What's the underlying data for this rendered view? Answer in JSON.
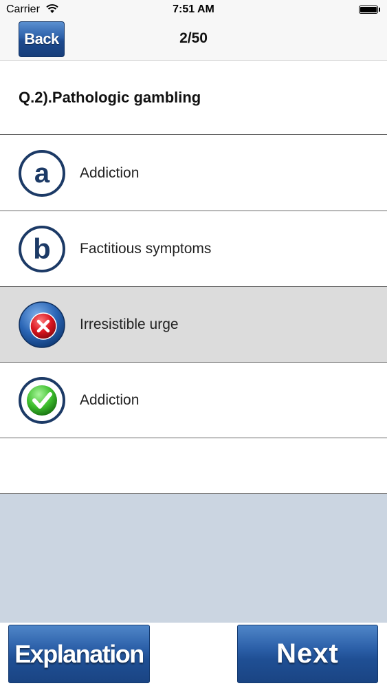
{
  "status_bar": {
    "carrier": "Carrier",
    "time": "7:51 AM"
  },
  "nav": {
    "back_label": "Back",
    "progress": "2/50"
  },
  "question": {
    "text": "Q.2).Pathologic gambling"
  },
  "options": [
    {
      "marker": "a",
      "icon": "letter-a-circle-icon",
      "label": "Addiction",
      "state": "normal"
    },
    {
      "marker": "b",
      "icon": "letter-b-circle-icon",
      "label": "Factitious symptoms",
      "state": "normal"
    },
    {
      "marker": "x",
      "icon": "wrong-answer-icon",
      "label": "Irresistible urge",
      "state": "selected-wrong"
    },
    {
      "marker": "check",
      "icon": "correct-answer-icon",
      "label": "Addiction",
      "state": "correct"
    }
  ],
  "buttons": {
    "explanation_label": "Explanation",
    "next_label": "Next"
  },
  "colors": {
    "accent_blue": "#1f4f94",
    "selected_row": "#dcdcdc",
    "footer_area": "#cbd5e1",
    "wrong_red": "#d8141e",
    "correct_green": "#3fbf2e"
  }
}
